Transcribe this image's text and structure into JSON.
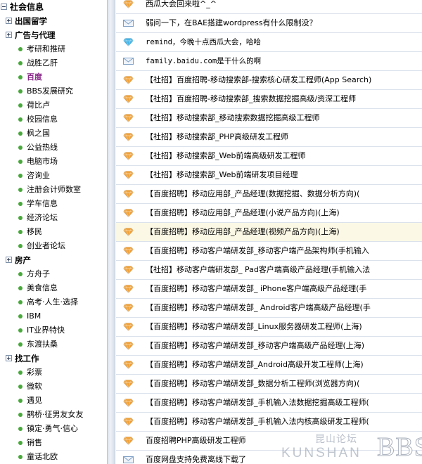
{
  "sidebar": {
    "title": "社会信息",
    "rows": [
      {
        "kind": "top",
        "label": "社会信息",
        "expanded": true
      },
      {
        "kind": "cat",
        "label": "出国留学",
        "expanded": false
      },
      {
        "kind": "cat",
        "label": "广告与代理",
        "expanded": false
      },
      {
        "kind": "item",
        "label": "考研和推研"
      },
      {
        "kind": "item",
        "label": "战胜乙肝"
      },
      {
        "kind": "item",
        "label": "百度",
        "active": true
      },
      {
        "kind": "item",
        "label": "BBS发展研究"
      },
      {
        "kind": "item",
        "label": "荷比卢"
      },
      {
        "kind": "item",
        "label": "校园信息"
      },
      {
        "kind": "item",
        "label": "枫之国"
      },
      {
        "kind": "item",
        "label": "公益热线"
      },
      {
        "kind": "item",
        "label": "电脑市场"
      },
      {
        "kind": "item",
        "label": "咨询业"
      },
      {
        "kind": "item",
        "label": "注册会计师数室"
      },
      {
        "kind": "item",
        "label": "学车信息"
      },
      {
        "kind": "item",
        "label": "经济论坛"
      },
      {
        "kind": "item",
        "label": "移民"
      },
      {
        "kind": "item",
        "label": "创业者论坛"
      },
      {
        "kind": "cat",
        "label": "房产",
        "expanded": false
      },
      {
        "kind": "item",
        "label": "方舟子"
      },
      {
        "kind": "item",
        "label": "美食信息"
      },
      {
        "kind": "item",
        "label": "高考·人生·选择"
      },
      {
        "kind": "item",
        "label": "IBM"
      },
      {
        "kind": "item",
        "label": "IT业界特快"
      },
      {
        "kind": "item",
        "label": "东渡扶桑"
      },
      {
        "kind": "cat",
        "label": "找工作",
        "expanded": false
      },
      {
        "kind": "item",
        "label": "彩票"
      },
      {
        "kind": "item",
        "label": "微软"
      },
      {
        "kind": "item",
        "label": "遇见"
      },
      {
        "kind": "item",
        "label": "鹊桥·征男友女友"
      },
      {
        "kind": "item",
        "label": "镇定·勇气·信心"
      },
      {
        "kind": "item",
        "label": "销售"
      },
      {
        "kind": "item",
        "label": "童话北欧"
      }
    ]
  },
  "threads": [
    {
      "icon": "orange-diamond",
      "title": "西瓜大会回来啦^_^"
    },
    {
      "icon": "envelope",
      "title": "弱问一下，在BAE搭建wordpress有什么限制没？"
    },
    {
      "icon": "blue-diamond",
      "title": "remind，今晚十点西瓜大会，哈哈",
      "mono": true
    },
    {
      "icon": "envelope",
      "title": "family.baidu.com是干什么的啊",
      "mono": true
    },
    {
      "icon": "orange-diamond",
      "title": "【社招】百度招聘-移动搜索部-搜索核心研发工程师(App Search)"
    },
    {
      "icon": "orange-diamond",
      "title": "【社招】百度招聘-移动搜索部_搜索数据挖掘高级/资深工程师"
    },
    {
      "icon": "orange-diamond",
      "title": "【社招】移动搜索部_移动搜索数据挖掘高级工程师"
    },
    {
      "icon": "orange-diamond",
      "title": "【社招】移动搜索部_PHP高级研发工程师"
    },
    {
      "icon": "orange-diamond",
      "title": "【社招】移动搜索部_Web前端高级研发工程师"
    },
    {
      "icon": "orange-diamond",
      "title": "【社招】移动搜索部_Web前端研发项目经理"
    },
    {
      "icon": "orange-diamond",
      "title": "【百度招聘】移动应用部_产品经理(数据挖掘、数据分析方向)("
    },
    {
      "icon": "orange-diamond",
      "title": "【百度招聘】移动应用部_产品经理(小说产品方向)(上海)"
    },
    {
      "icon": "orange-diamond",
      "title": "【百度招聘】移动应用部_产品经理(视频产品方向)(上海)",
      "highlight": true
    },
    {
      "icon": "orange-diamond",
      "title": "【百度招聘】移动客户端研发部_移动客户端产品架构师(手机输入"
    },
    {
      "icon": "orange-diamond",
      "title": "【社招】移动客户端研发部_ Pad客户端高级产品经理(手机输入法"
    },
    {
      "icon": "orange-diamond",
      "title": "【百度招聘】移动客户端研发部_ iPhone客户端高级产品经理(手"
    },
    {
      "icon": "orange-diamond",
      "title": "【百度招聘】移动客户端研发部_ Android客户端高级产品经理(手"
    },
    {
      "icon": "orange-diamond",
      "title": "【百度招聘】移动客户端研发部_Linux服务器研发工程师(上海)"
    },
    {
      "icon": "orange-diamond",
      "title": "【百度招聘】移动客户端研发部_移动客户端高级产品经理(上海)"
    },
    {
      "icon": "orange-diamond",
      "title": "【百度招聘】移动客户端研发部_Android高级开发工程师(上海)"
    },
    {
      "icon": "orange-diamond",
      "title": "【百度招聘】移动客户端研发部_数据分析工程师(浏览器方向)("
    },
    {
      "icon": "orange-diamond",
      "title": "【百度招聘】移动客户端研发部_手机输入法数据挖掘高级工程师("
    },
    {
      "icon": "orange-diamond",
      "title": "【百度招聘】移动客户端研发部_手机输入法内核高级研发工程师("
    },
    {
      "icon": "orange-diamond",
      "title": "百度招聘PHP高级研发工程师"
    },
    {
      "icon": "envelope",
      "title": "百度网盘支持免费离线下载了"
    }
  ],
  "watermark": {
    "cn": "昆山论坛",
    "en": "KUNSHAN",
    "bbs": "BBS"
  },
  "colors": {
    "dot": "#49a83c",
    "active": "#8a2a8a",
    "diamond_orange": "#f0a23a",
    "diamond_blue": "#46b4e6",
    "envelope": "#7e9fc4",
    "row_highlight": "#fbf8e6"
  }
}
